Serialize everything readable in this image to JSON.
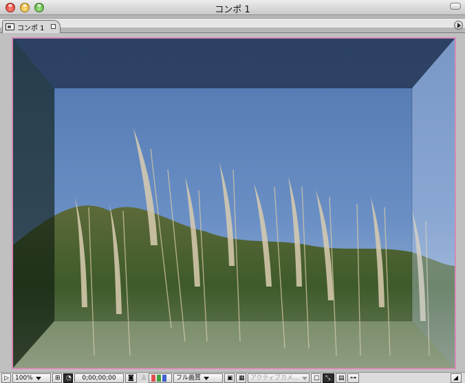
{
  "window": {
    "title": "コンポ 1"
  },
  "tab": {
    "label": "コンポ 1"
  },
  "viewer": {
    "frame_color": "#d98ab7"
  },
  "toolbar": {
    "magnification": "100%",
    "timecode": "0;00;00;00",
    "resolution": "フル画質",
    "active_camera": "アクティブカメ...",
    "channel_colors": [
      "#e05050",
      "#40a040",
      "#4060d0"
    ]
  },
  "colors": {
    "sky_top": "#5077b0",
    "sky_bottom": "#b7c9d9",
    "box_shadow_left": "#0d1a10",
    "box_shadow_top": "#1e2d45"
  }
}
